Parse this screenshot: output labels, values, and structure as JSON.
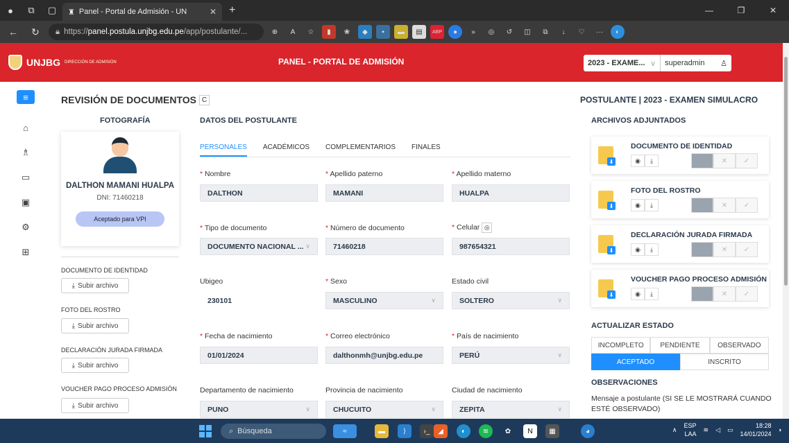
{
  "browser": {
    "tab_title": "Panel - Portal de Admisión - UN",
    "url_prefix": "https://",
    "url_domain": "panel.postula.unjbg.edu.pe",
    "url_path": "/app/postulante/..."
  },
  "header": {
    "logo_text": "UNJBG",
    "logo_sub": "DIRECCIÓN DE ADMISIÓN",
    "title": "PANEL - PORTAL DE ADMISIÓN",
    "exam_select": "2023 - EXAME...",
    "username": "superadmin"
  },
  "page": {
    "title": "REVISIÓN DE DOCUMENTOS",
    "photo_heading": "FOTOGRAFÍA",
    "data_heading": "DATOS DEL POSTULANTE",
    "right_title": "POSTULANTE | 2023 - EXAMEN SIMULACRO"
  },
  "applicant": {
    "name": "DALTHON MAMANI HUALPA",
    "dni_label": "DNI: 71460218",
    "status_badge": "Aceptado para VPI"
  },
  "uploads": [
    {
      "label": "DOCUMENTO DE IDENTIDAD",
      "button": "Subir archivo"
    },
    {
      "label": "FOTO DEL ROSTRO",
      "button": "Subir archivo"
    },
    {
      "label": "DECLARACIÓN JURADA FIRMADA",
      "button": "Subir archivo"
    },
    {
      "label": "VOUCHER PAGO PROCESO ADMISIÓN",
      "button": "Subir archivo"
    }
  ],
  "tabs": [
    "PERSONALES",
    "ACADÉMICOS",
    "COMPLEMENTARIOS",
    "FINALES"
  ],
  "fields": {
    "nombre": {
      "label": "Nombre",
      "value": "DALTHON"
    },
    "ap_paterno": {
      "label": "Apellido paterno",
      "value": "MAMANI"
    },
    "ap_materno": {
      "label": "Apellido materno",
      "value": "HUALPA"
    },
    "tipo_doc": {
      "label": "Tipo de documento",
      "value": "DOCUMENTO NACIONAL ..."
    },
    "num_doc": {
      "label": "Número de documento",
      "value": "71460218"
    },
    "celular": {
      "label": "Celular",
      "value": "987654321"
    },
    "ubigeo": {
      "label": "Ubigeo",
      "value": "230101"
    },
    "sexo": {
      "label": "Sexo",
      "value": "MASCULINO"
    },
    "estado_civil": {
      "label": "Estado civil",
      "value": "SOLTERO"
    },
    "fecha_nac": {
      "label": "Fecha de nacimiento",
      "value": "01/01/2024"
    },
    "correo": {
      "label": "Correo electrónico",
      "value": "dalthonmh@unjbg.edu.pe"
    },
    "pais_nac": {
      "label": "País de nacimiento",
      "value": "PERÚ"
    },
    "depto_nac": {
      "label": "Departamento de nacimiento",
      "value": "PUNO"
    },
    "prov_nac": {
      "label": "Provincia de nacimiento",
      "value": "CHUCUITO"
    },
    "ciudad_nac": {
      "label": "Ciudad de nacimiento",
      "value": "ZEPITA"
    }
  },
  "attachments": {
    "heading": "ARCHIVOS ADJUNTADOS",
    "items": [
      {
        "name": "DOCUMENTO DE IDENTIDAD"
      },
      {
        "name": "FOTO DEL ROSTRO"
      },
      {
        "name": "DECLARACIÓN JURADA FIRMADA"
      },
      {
        "name": "VOUCHER PAGO PROCESO ADMISIÓN"
      }
    ]
  },
  "estado": {
    "heading": "ACTUALIZAR ESTADO",
    "row1": [
      "INCOMPLETO",
      "PENDIENTE",
      "OBSERVADO"
    ],
    "row2": [
      "ACEPTADO",
      "INSCRITO"
    ],
    "selected": "ACEPTADO"
  },
  "observaciones": {
    "heading": "OBSERVACIONES",
    "text": "Mensaje a postulante (SI SE LE MOSTRARÁ CUANDO ESTÉ OBSERVADO)"
  },
  "taskbar": {
    "search": "Búsqueda",
    "lang": "ESP",
    "lang_sub": "LAA",
    "time": "18:28",
    "date": "14/01/2024"
  },
  "colors": {
    "header_red": "#d9252b",
    "accent_blue": "#1f8fff",
    "taskbar": "#1e3a5a"
  }
}
